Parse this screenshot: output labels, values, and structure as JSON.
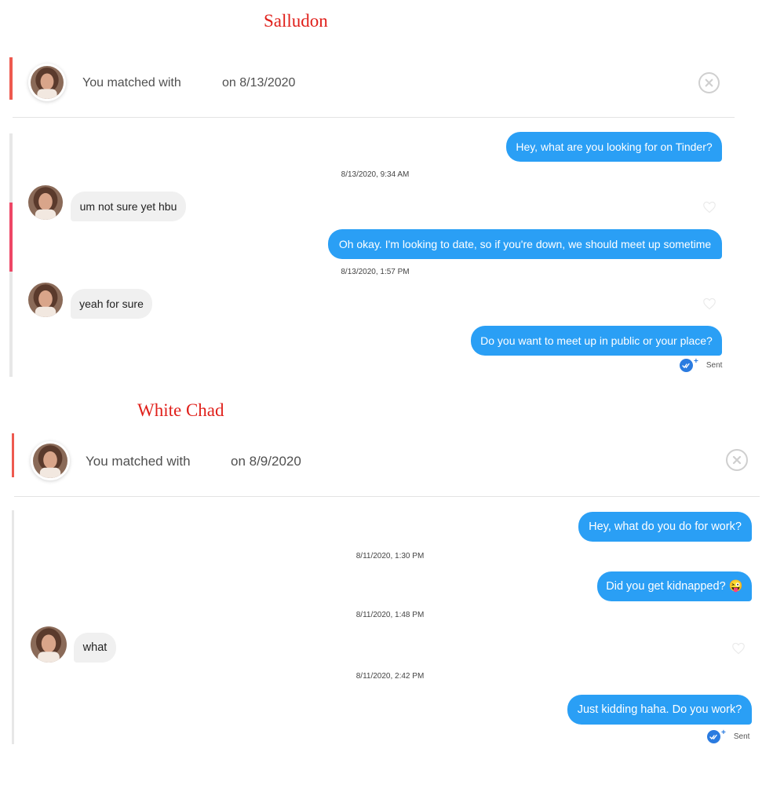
{
  "panels": [
    {
      "caption": "Salludon",
      "match": {
        "prefix": "You matched with",
        "date": "on 8/13/2020"
      },
      "messages": [
        {
          "dir": "out",
          "text": "Hey, what are you looking for on Tinder?"
        },
        {
          "dir": "ts",
          "text": "8/13/2020, 9:34 AM"
        },
        {
          "dir": "in",
          "text": "um not sure yet hbu"
        },
        {
          "dir": "out",
          "text": "Oh okay. I'm looking to date, so if you're down, we should meet up sometime"
        },
        {
          "dir": "ts",
          "text": "8/13/2020, 1:57 PM"
        },
        {
          "dir": "in",
          "text": "yeah for sure"
        },
        {
          "dir": "out",
          "text": "Do you want to meet up in public or your place?"
        }
      ],
      "status": "Sent"
    },
    {
      "caption": "White Chad",
      "match": {
        "prefix": "You matched with",
        "date": "on 8/9/2020"
      },
      "messages": [
        {
          "dir": "out",
          "text": "Hey, what do you do for work?"
        },
        {
          "dir": "ts",
          "text": "8/11/2020, 1:30 PM"
        },
        {
          "dir": "out",
          "text": "Did you get kidnapped? 😜"
        },
        {
          "dir": "ts",
          "text": "8/11/2020, 1:48 PM"
        },
        {
          "dir": "in",
          "text": "what"
        },
        {
          "dir": "ts",
          "text": "8/11/2020, 2:42 PM"
        },
        {
          "dir": "out",
          "text": "Just kidding haha. Do you work?"
        }
      ],
      "status": "Sent"
    }
  ],
  "colors": {
    "caption": "#e0201b",
    "outgoing_bubble": "#2a9ff5",
    "incoming_bubble": "#f0f0f0",
    "accent": "#ee5a4f",
    "sent_check": "#2a7be0"
  },
  "icons": {
    "close": "close-icon",
    "like": "heart-icon",
    "read_receipt": "double-check-icon"
  }
}
